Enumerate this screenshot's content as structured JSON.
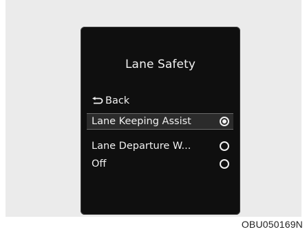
{
  "screen": {
    "title": "Lane Safety",
    "back_label": "Back",
    "back_icon": "return-arrow-icon",
    "items": [
      {
        "label": "Lane Keeping Assist",
        "selected": true
      },
      {
        "label": "Lane Departure W...",
        "selected": false
      },
      {
        "label": "Off",
        "selected": false
      }
    ]
  },
  "caption": "OBU050169N",
  "colors": {
    "screen_bg": "#0f0f0f",
    "text": "#f0f0f0",
    "highlight_bg": "#2b2b2b",
    "page_bg": "#ebebeb"
  }
}
